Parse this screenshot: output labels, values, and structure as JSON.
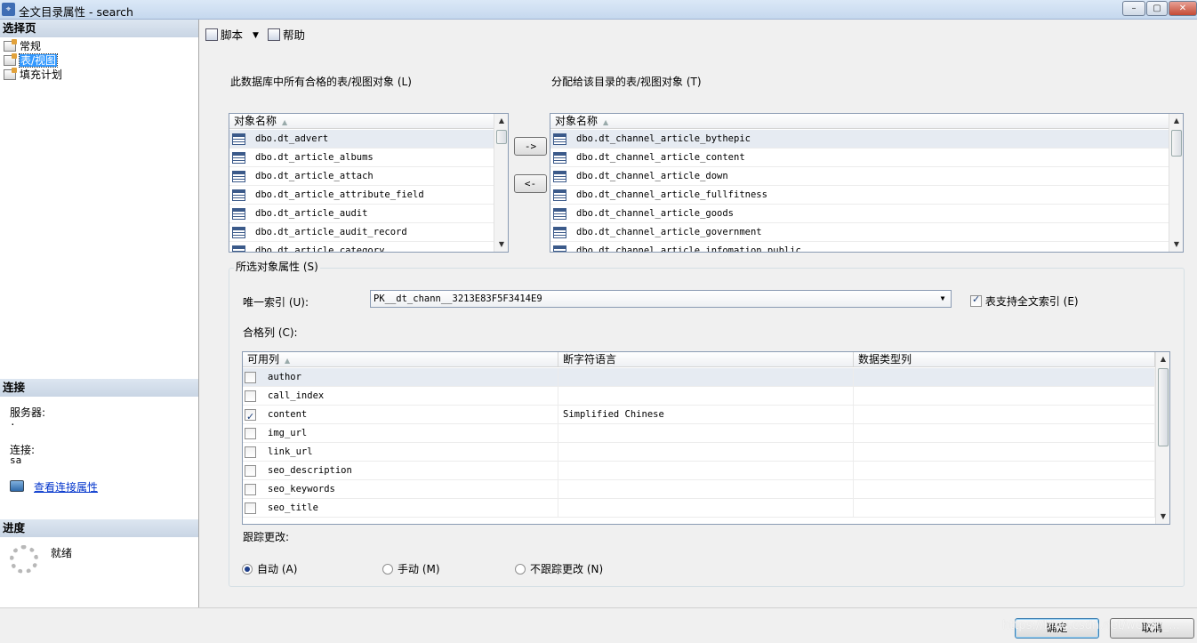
{
  "window": {
    "title": "全文目录属性 - search",
    "app_icon": "ssms-icon",
    "min": "–",
    "max": "▢",
    "close": "✕"
  },
  "left": {
    "select_page_header": "选择页",
    "pages": [
      {
        "label": "常规",
        "icon": "page-icon"
      },
      {
        "label": "表/视图",
        "icon": "page-icon"
      },
      {
        "label": "填充计划",
        "icon": "page-icon"
      }
    ],
    "connection_header": "连接",
    "server_label": "服务器:",
    "server_value": ".",
    "connection_label": "连接:",
    "connection_value": "sa",
    "view_connection_link": "查看连接属性",
    "progress_header": "进度",
    "progress_status": "就绪"
  },
  "toolbar": {
    "script_label": "脚本",
    "dropdown_arrow": "▼",
    "help_label": "帮助"
  },
  "tables": {
    "available_label": "此数据库中所有合格的表/视图对象 (L)",
    "assigned_label": "分配给该目录的表/视图对象 (T)",
    "column_header": "对象名称",
    "sort_glyph": "▲",
    "available": [
      "dbo.dt_advert",
      "dbo.dt_article_albums",
      "dbo.dt_article_attach",
      "dbo.dt_article_attribute_field",
      "dbo.dt_article_audit",
      "dbo.dt_article_audit_record",
      "dbo.dt_article_category"
    ],
    "assigned": [
      "dbo.dt_channel_article_bythepic",
      "dbo.dt_channel_article_content",
      "dbo.dt_channel_article_down",
      "dbo.dt_channel_article_fullfitness",
      "dbo.dt_channel_article_goods",
      "dbo.dt_channel_article_government",
      "dbo.dt_channel_article_infomation_public"
    ],
    "add_button": "->",
    "remove_button": "<-"
  },
  "props": {
    "group_title": "所选对象属性 (S)",
    "unique_index_label": "唯一索引 (U):",
    "unique_index_value": "PK__dt_chann__3213E83F5F3414E9",
    "fulltext_checkbox_label": "表支持全文索引 (E)",
    "fulltext_checked": true,
    "eligible_columns_label": "合格列 (C):",
    "grid_headers": [
      "可用列",
      "断字符语言",
      "数据类型列"
    ],
    "columns": [
      {
        "name": "author",
        "checked": false,
        "language": "",
        "type_col": ""
      },
      {
        "name": "call_index",
        "checked": false,
        "language": "",
        "type_col": ""
      },
      {
        "name": "content",
        "checked": true,
        "language": "Simplified Chinese",
        "type_col": ""
      },
      {
        "name": "img_url",
        "checked": false,
        "language": "",
        "type_col": ""
      },
      {
        "name": "link_url",
        "checked": false,
        "language": "",
        "type_col": ""
      },
      {
        "name": "seo_description",
        "checked": false,
        "language": "",
        "type_col": ""
      },
      {
        "name": "seo_keywords",
        "checked": false,
        "language": "",
        "type_col": ""
      },
      {
        "name": "seo_title",
        "checked": false,
        "language": "",
        "type_col": ""
      }
    ],
    "tracking_label": "跟踪更改:",
    "tracking_options": [
      {
        "label": "自动 (A)",
        "selected": true
      },
      {
        "label": "手动 (M)",
        "selected": false
      },
      {
        "label": "不跟踪更改 (N)",
        "selected": false
      }
    ]
  },
  "buttons": {
    "ok": "确定",
    "cancel": "取消"
  },
  "watermark": "https://blog.csdn.net/weixin_..."
}
